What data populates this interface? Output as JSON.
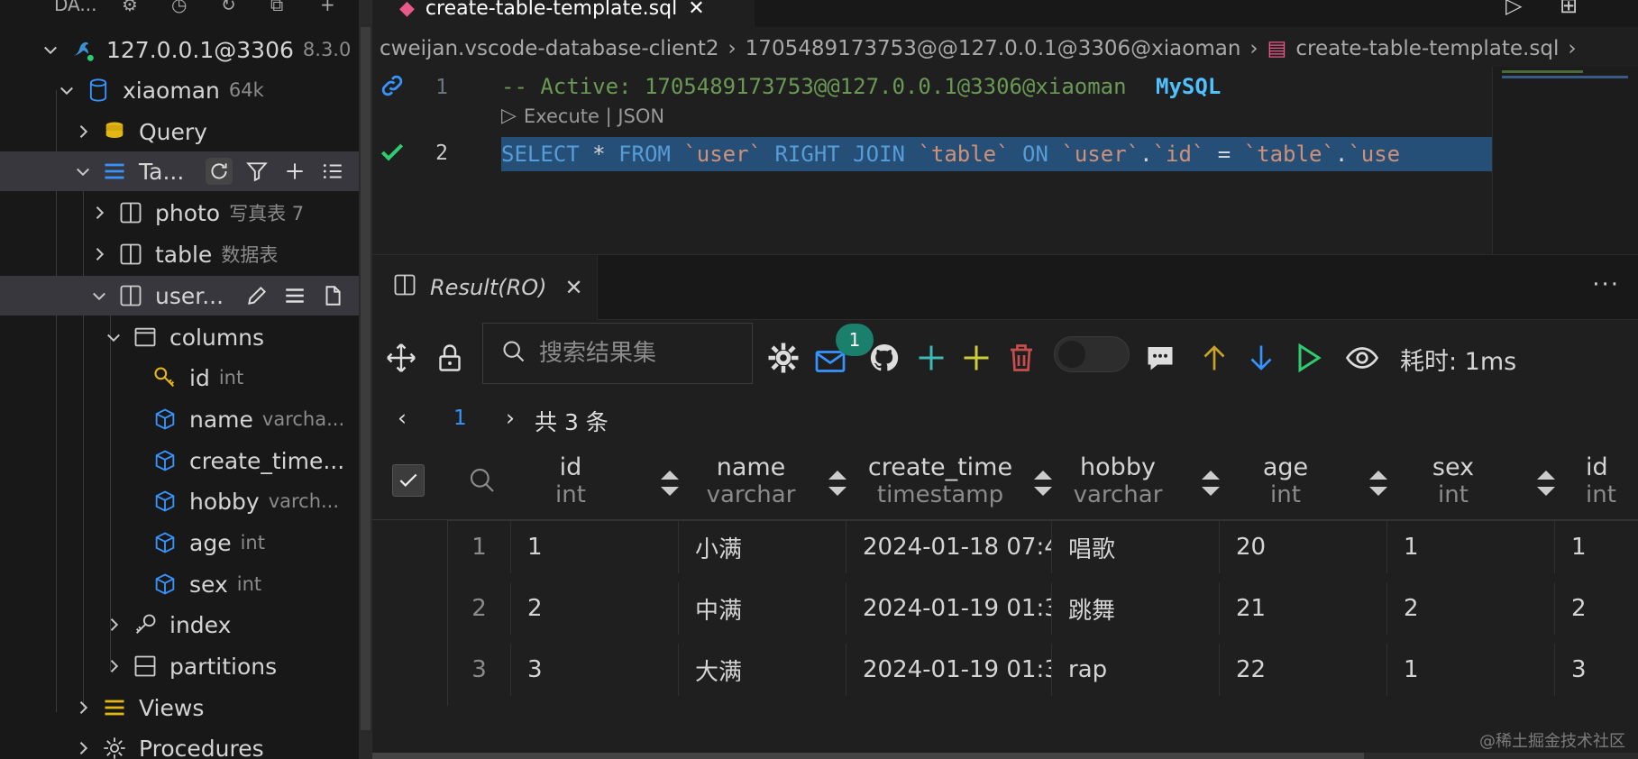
{
  "sidebar": {
    "header_label": "DA...",
    "tree": [
      {
        "label": "127.0.0.1@3306",
        "desc": "8.3.0"
      },
      {
        "label": "xiaoman",
        "desc": "64k"
      },
      {
        "label": "Query",
        "desc": ""
      },
      {
        "label": "Ta...",
        "desc": ""
      },
      {
        "label": "photo",
        "desc": "写真表 7"
      },
      {
        "label": "table",
        "desc": "数据表"
      },
      {
        "label": "user...",
        "desc": ""
      },
      {
        "label": "columns",
        "desc": ""
      },
      {
        "label": "id",
        "desc": "int"
      },
      {
        "label": "name",
        "desc": "varcha..."
      },
      {
        "label": "create_time...",
        "desc": ""
      },
      {
        "label": "hobby",
        "desc": "varch..."
      },
      {
        "label": "age",
        "desc": "int"
      },
      {
        "label": "sex",
        "desc": "int"
      },
      {
        "label": "index",
        "desc": ""
      },
      {
        "label": "partitions",
        "desc": ""
      },
      {
        "label": "Views",
        "desc": ""
      },
      {
        "label": "Procedures",
        "desc": ""
      }
    ]
  },
  "editor": {
    "tab_label": "create-table-template.sql",
    "breadcrumb": [
      "cweijan.vscode-database-client2",
      "1705489173753@@127.0.0.1@3306@xiaoman",
      "create-table-template.sql"
    ],
    "line1_num": "1",
    "line1_comment": "-- Active: 1705489173753@@127.0.0.1@3306@xiaoman",
    "line1_dialect": "MySQL",
    "codelens": "Execute | JSON",
    "line2_num": "2",
    "line2_sql": {
      "kw_select": "SELECT",
      "star": "*",
      "kw_from": "FROM",
      "t_user": "`user`",
      "kw_right_join": "RIGHT JOIN",
      "t_table": "`table`",
      "kw_on": "ON",
      "t_user2": "`user`",
      "dot1": ".",
      "c_id": "`id`",
      "eq": "=",
      "t_table2": "`table`",
      "dot2": ".",
      "c_use": "`use"
    }
  },
  "result": {
    "tab_label": "Result(RO)",
    "search_placeholder": "搜索结果集",
    "badge_count": "1",
    "elapsed": "耗时: 1ms",
    "page_current": "1",
    "total_label": "共 3 条",
    "more": "···",
    "columns": [
      {
        "name": "id",
        "type": "int"
      },
      {
        "name": "name",
        "type": "varchar"
      },
      {
        "name": "create_time",
        "type": "timestamp"
      },
      {
        "name": "hobby",
        "type": "varchar"
      },
      {
        "name": "age",
        "type": "int"
      },
      {
        "name": "sex",
        "type": "int"
      },
      {
        "name": "id",
        "type": "int"
      }
    ],
    "rows": [
      {
        "idx": "1",
        "cells": [
          "1",
          "小满",
          "2024-01-18 07:4",
          "唱歌",
          "20",
          "1",
          "1"
        ]
      },
      {
        "idx": "2",
        "cells": [
          "2",
          "中满",
          "2024-01-19 01:3",
          "跳舞",
          "21",
          "2",
          "2"
        ]
      },
      {
        "idx": "3",
        "cells": [
          "3",
          "大满",
          "2024-01-19 01:3",
          "rap",
          "22",
          "1",
          "3"
        ]
      }
    ]
  },
  "watermark": "@稀土掘金技术社区",
  "colors": {
    "accent_blue": "#3794ff",
    "keyword_blue": "#569cd6",
    "comment_green": "#6a9955",
    "string_orange": "#ce9178",
    "badge_teal": "#1a7f6b",
    "delete_red": "#c74e4e",
    "add_teal": "#3fb9b3",
    "add_yellow": "#cdcd3a"
  }
}
